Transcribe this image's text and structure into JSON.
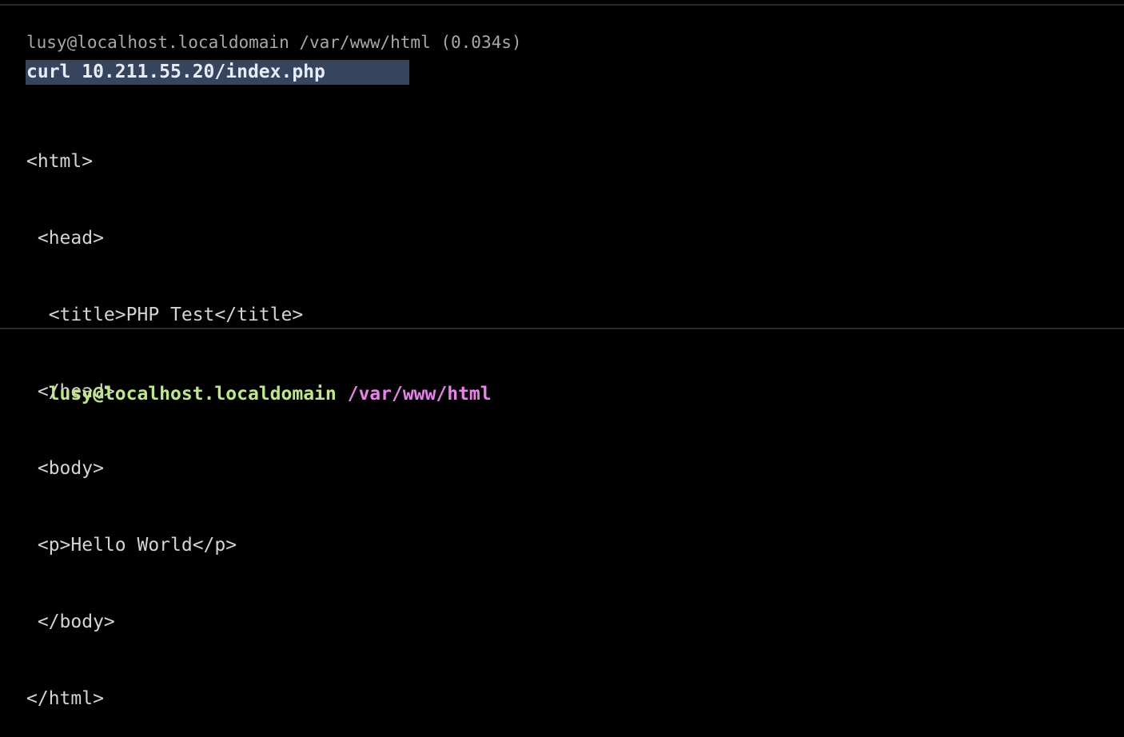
{
  "terminal": {
    "block": {
      "header": "lusy@localhost.localdomain /var/www/html (0.034s)",
      "command": "curl 10.211.55.20/index.php",
      "output_lines": [
        "<html>",
        " <head>",
        "  <title>PHP Test</title>",
        " </head>",
        " <body>",
        " <p>Hello World</p>",
        " </body>",
        "</html>"
      ]
    },
    "prompt": {
      "user_host": "lusy@localhost.localdomain",
      "path": "/var/www/html"
    }
  },
  "colors": {
    "background": "#000000",
    "selection": "#36455d",
    "prompt_user": "#bdea7d",
    "prompt_path": "#ee7ff0",
    "header_text": "#a8a8a8"
  }
}
